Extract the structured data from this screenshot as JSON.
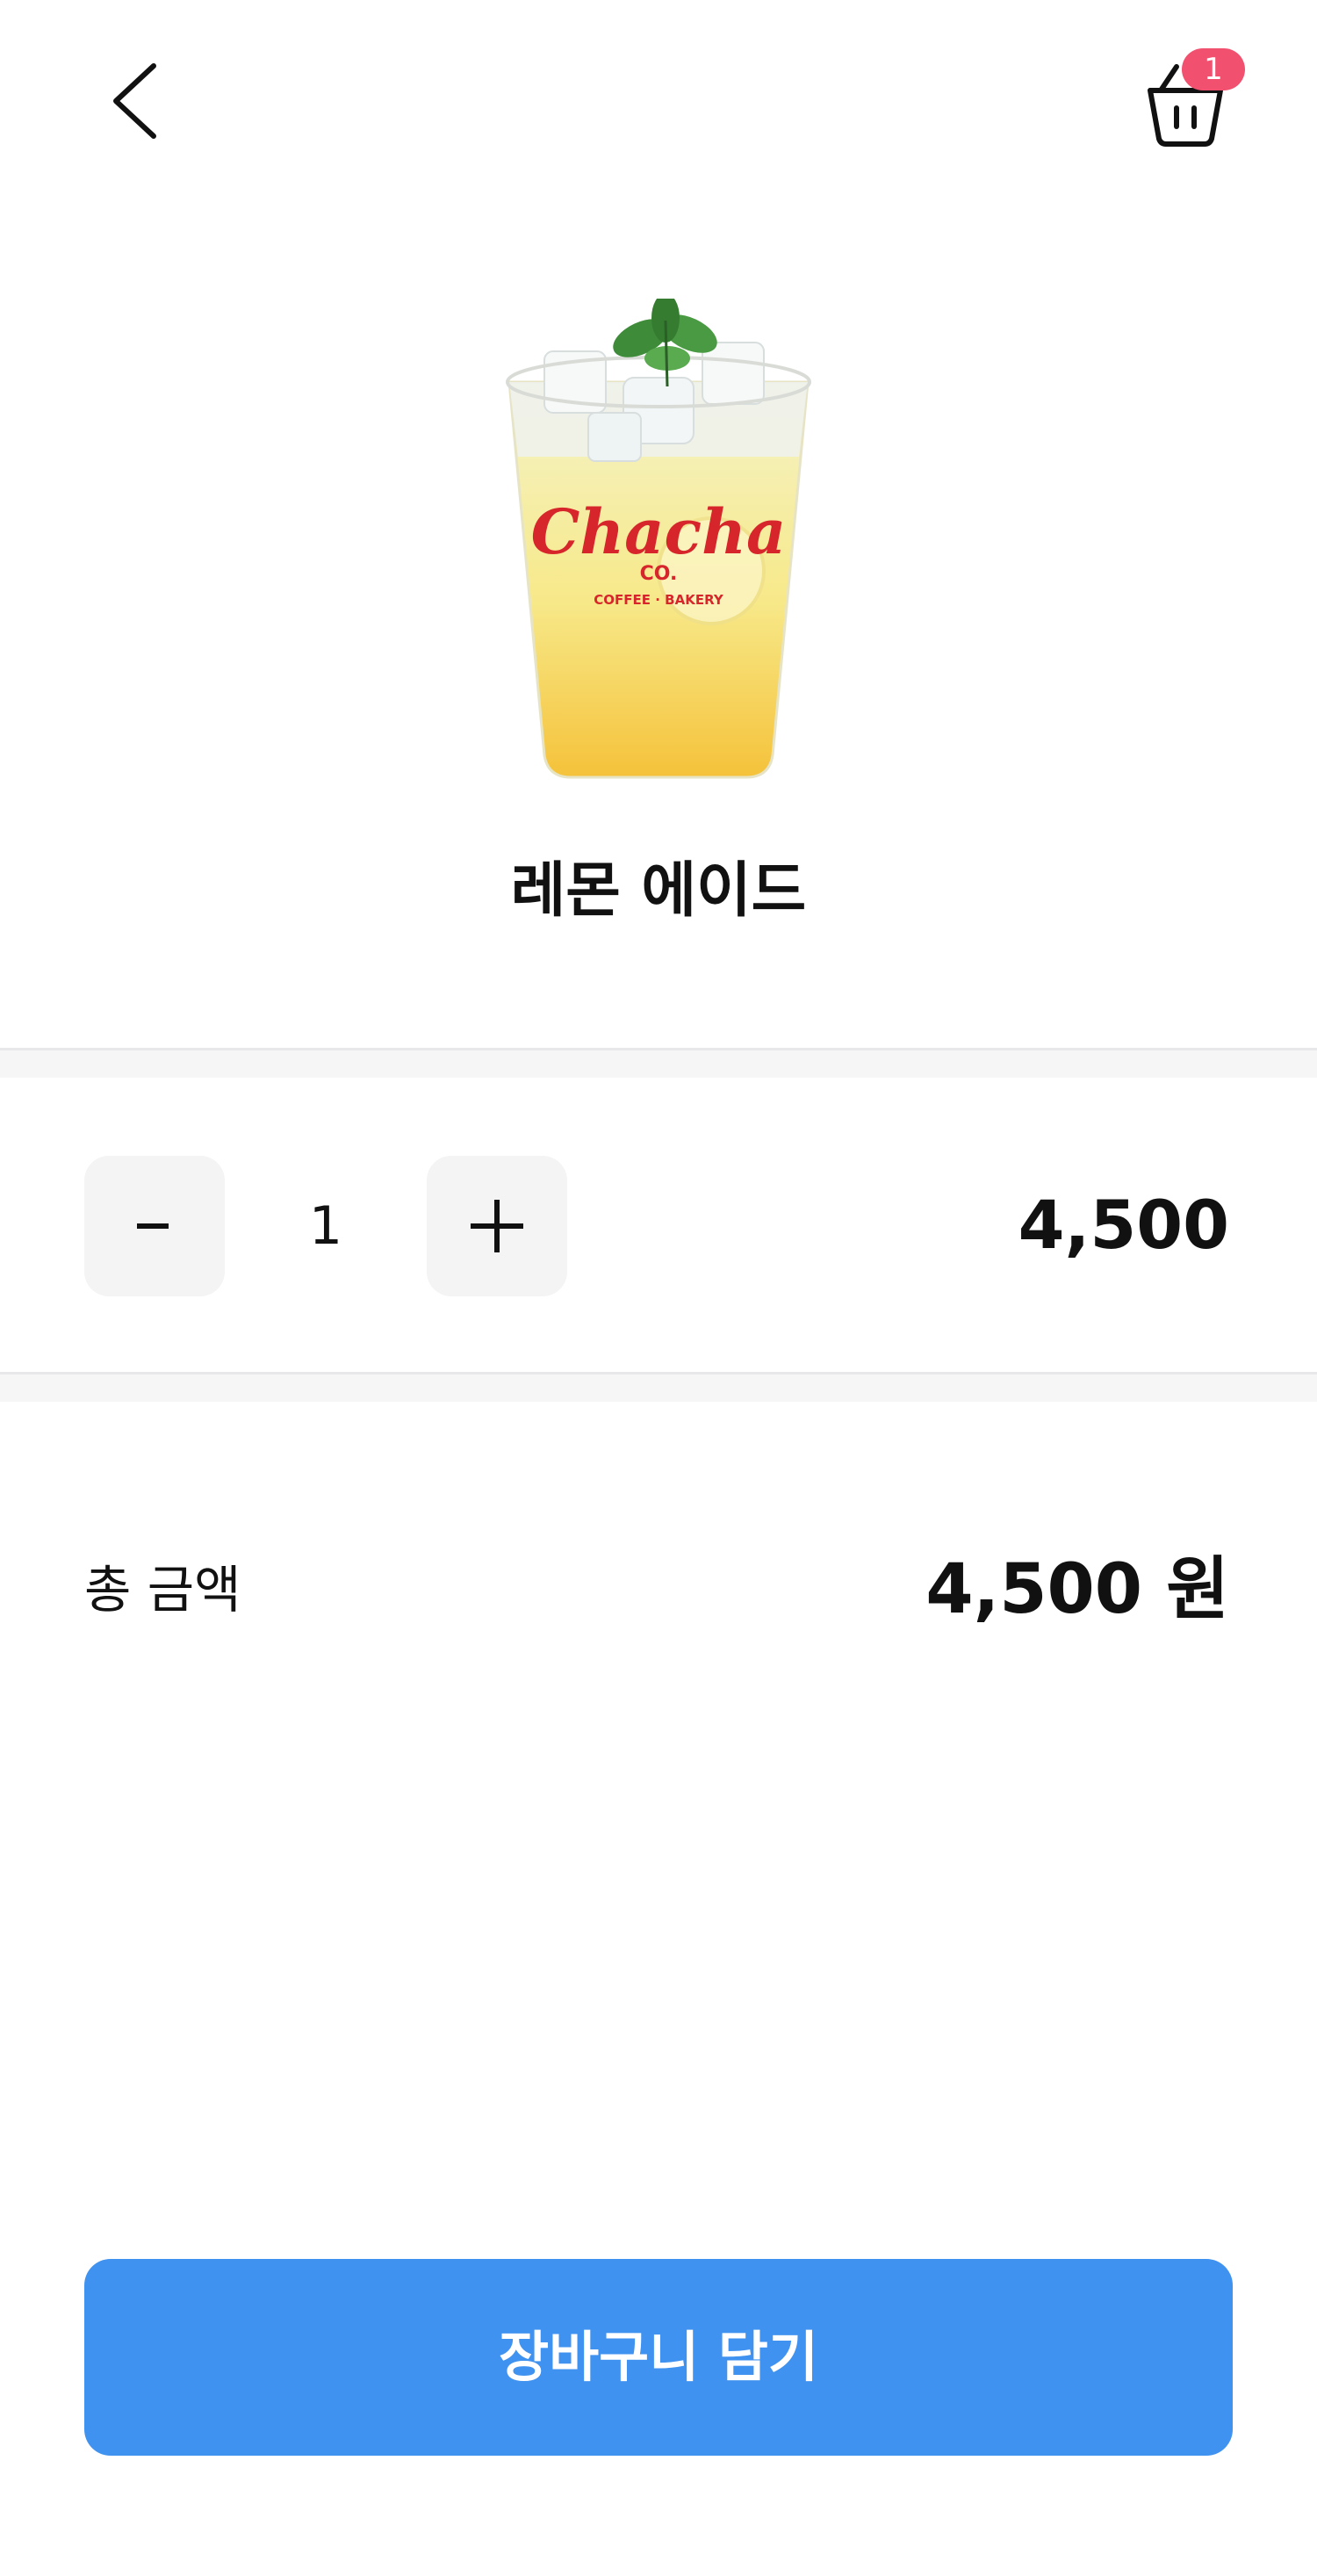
{
  "header": {
    "back_icon": "chevron-left-icon",
    "cart_icon": "shopping-basket-icon",
    "cart_badge_count": "1",
    "badge_color": "#f2506f"
  },
  "product": {
    "name": "레몬 에이드",
    "image_brand_text": "Chacha",
    "image_brand_sub": "CO.",
    "image_brand_tagline": "COFFEE BAKERY"
  },
  "quantity": {
    "minus_label": "-",
    "value": "1",
    "plus_label": "+",
    "line_price": "4,500"
  },
  "total": {
    "label": "총 금액",
    "amount": "4,500 원"
  },
  "cta": {
    "label": "장바구니 담기",
    "color": "#3f92f0"
  }
}
